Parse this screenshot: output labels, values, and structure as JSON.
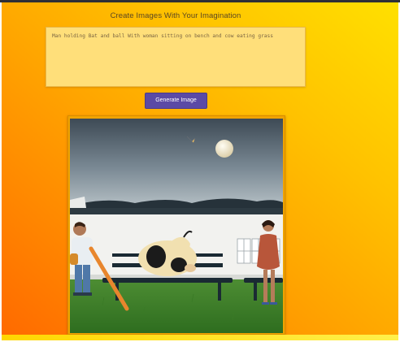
{
  "header": {
    "title": "Create Images With Your Imagination"
  },
  "prompt": {
    "value": "Man holding Bat and ball With woman sitting on bench and cow eating grass"
  },
  "actions": {
    "generate_label": "Generate Image"
  },
  "result": {
    "image_subject": "generated-image",
    "colors": {
      "accent": "#5b4aa5",
      "background_start": "#ff6a00",
      "background_end": "#ffe000"
    }
  }
}
